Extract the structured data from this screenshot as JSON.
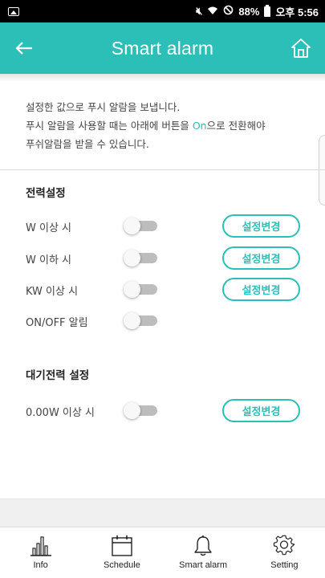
{
  "status_bar": {
    "battery_percent": "88%",
    "time": "오후 5:56"
  },
  "header": {
    "title": "Smart alarm",
    "back_icon": "arrow-left-icon",
    "home_icon": "home-icon"
  },
  "description": {
    "line1": "설정한 값으로 푸시 알람을 보냅니다.",
    "line2_before": "푸시 알람을 사용할 때는 아래에 버튼을 ",
    "line2_accent": "On",
    "line2_after": "으로 전환해야",
    "line3": "푸쉬알람을 받을 수 있습니다."
  },
  "power_section": {
    "title": "전력설정",
    "rows": [
      {
        "label": "W 이상 시",
        "toggle_on": false,
        "button_label": "설정변경"
      },
      {
        "label": "W 이하 시",
        "toggle_on": false,
        "button_label": "설정변경"
      },
      {
        "label": "KW 이상 시",
        "toggle_on": false,
        "button_label": "설정변경"
      },
      {
        "label": "ON/OFF 알림",
        "toggle_on": false
      }
    ]
  },
  "standby_section": {
    "title": "대기전력 설정",
    "rows": [
      {
        "label": "0.00W 이상 시",
        "toggle_on": false,
        "button_label": "설정변경"
      }
    ]
  },
  "bottom_nav": {
    "items": [
      {
        "label": "Info",
        "icon": "bar-chart-icon"
      },
      {
        "label": "Schedule",
        "icon": "calendar-icon"
      },
      {
        "label": "Smart alarm",
        "icon": "bell-icon"
      },
      {
        "label": "Setting",
        "icon": "gear-icon"
      }
    ]
  },
  "colors": {
    "accent": "#2bbfb8",
    "toggle_off": "#bdbdbd"
  }
}
